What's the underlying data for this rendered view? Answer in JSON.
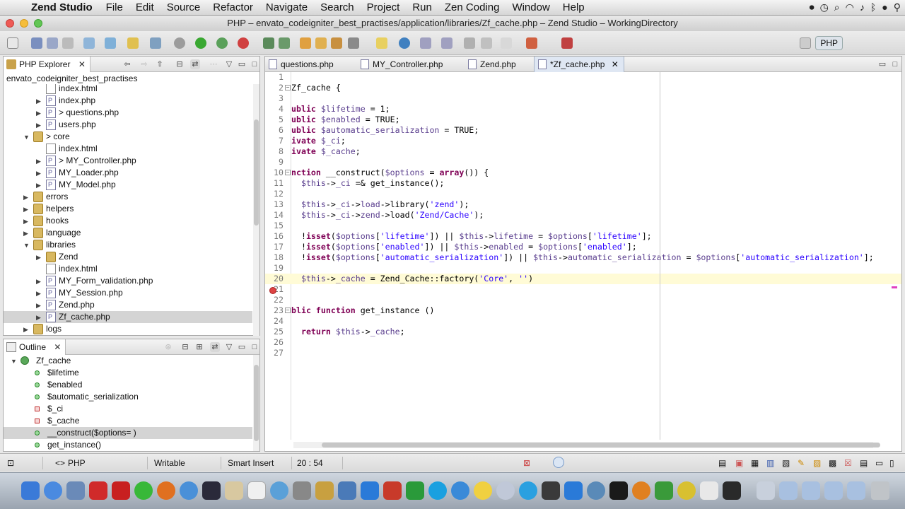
{
  "menubar": {
    "app_name": "Zend Studio",
    "items": [
      "File",
      "Edit",
      "Source",
      "Refactor",
      "Navigate",
      "Search",
      "Project",
      "Run",
      "Zen Coding",
      "Window",
      "Help"
    ]
  },
  "window": {
    "title": "PHP – envato_codeigniter_best_practises/application/libraries/Zf_cache.php – Zend Studio – WorkingDirectory"
  },
  "toolbar": {
    "perspective_label": "PHP"
  },
  "php_explorer": {
    "tab_label": "PHP Explorer",
    "project_name": "envato_codeigniter_best_practises",
    "tree": [
      {
        "label": "index.html",
        "indent": 3,
        "icon": "file",
        "twisty": ""
      },
      {
        "label": "index.php",
        "indent": 3,
        "icon": "php",
        "twisty": "▶"
      },
      {
        "label": "> questions.php",
        "indent": 3,
        "icon": "php",
        "twisty": "▶"
      },
      {
        "label": "users.php",
        "indent": 3,
        "icon": "php",
        "twisty": "▶"
      },
      {
        "label": "> core",
        "indent": 2,
        "icon": "pkg",
        "twisty": "▼"
      },
      {
        "label": "index.html",
        "indent": 3,
        "icon": "file",
        "twisty": ""
      },
      {
        "label": "> MY_Controller.php",
        "indent": 3,
        "icon": "php",
        "twisty": "▶"
      },
      {
        "label": "MY_Loader.php",
        "indent": 3,
        "icon": "php",
        "twisty": "▶"
      },
      {
        "label": "MY_Model.php",
        "indent": 3,
        "icon": "php",
        "twisty": "▶"
      },
      {
        "label": "errors",
        "indent": 2,
        "icon": "pkg",
        "twisty": "▶"
      },
      {
        "label": "helpers",
        "indent": 2,
        "icon": "pkg",
        "twisty": "▶"
      },
      {
        "label": "hooks",
        "indent": 2,
        "icon": "pkg",
        "twisty": "▶"
      },
      {
        "label": "language",
        "indent": 2,
        "icon": "pkg",
        "twisty": "▶"
      },
      {
        "label": "libraries",
        "indent": 2,
        "icon": "pkg",
        "twisty": "▼"
      },
      {
        "label": "Zend",
        "indent": 3,
        "icon": "pkg",
        "twisty": "▶"
      },
      {
        "label": "index.html",
        "indent": 3,
        "icon": "file",
        "twisty": ""
      },
      {
        "label": "MY_Form_validation.php",
        "indent": 3,
        "icon": "php",
        "twisty": "▶"
      },
      {
        "label": "MY_Session.php",
        "indent": 3,
        "icon": "php",
        "twisty": "▶"
      },
      {
        "label": "Zend.php",
        "indent": 3,
        "icon": "php",
        "twisty": "▶"
      },
      {
        "label": "Zf_cache.php",
        "indent": 3,
        "icon": "php",
        "twisty": "▶",
        "selected": true
      },
      {
        "label": "logs",
        "indent": 2,
        "icon": "pkg",
        "twisty": "▶"
      }
    ]
  },
  "outline": {
    "tab_label": "Outline",
    "root": "Zf_cache",
    "items": [
      {
        "label": "$lifetime",
        "kind": "public"
      },
      {
        "label": "$enabled",
        "kind": "public"
      },
      {
        "label": "$automatic_serialization",
        "kind": "public"
      },
      {
        "label": "$_ci",
        "kind": "private"
      },
      {
        "label": "$_cache",
        "kind": "private"
      },
      {
        "label": "__construct($options= )",
        "kind": "public",
        "selected": true
      },
      {
        "label": "get_instance()",
        "kind": "public"
      }
    ]
  },
  "editor": {
    "tabs": [
      {
        "label": "questions.php",
        "active": false
      },
      {
        "label": "MY_Controller.php",
        "active": false
      },
      {
        "label": "Zend.php",
        "active": false
      },
      {
        "label": "*Zf_cache.php",
        "active": true
      }
    ],
    "lines": [
      {
        "n": "1",
        "fold": "",
        "html": ""
      },
      {
        "n": "2",
        "fold": "⊟",
        "html": "Zf_cache {"
      },
      {
        "n": "3",
        "fold": "",
        "html": ""
      },
      {
        "n": "4",
        "fold": "",
        "html": "<span class=\"kw\">ublic</span> <span class=\"vr\">$lifetime</span> = 1;"
      },
      {
        "n": "5",
        "fold": "",
        "html": "<span class=\"kw\">ublic</span> <span class=\"vr\">$enabled</span> = TRUE;"
      },
      {
        "n": "6",
        "fold": "",
        "html": "<span class=\"kw\">ublic</span> <span class=\"vr\">$automatic_serialization</span> = TRUE;"
      },
      {
        "n": "7",
        "fold": "",
        "html": "<span class=\"kw\">ivate</span> <span class=\"vr\">$_ci</span>;"
      },
      {
        "n": "8",
        "fold": "",
        "html": "<span class=\"kw\">ivate</span> <span class=\"vr\">$_cache</span>;"
      },
      {
        "n": "9",
        "fold": "",
        "html": ""
      },
      {
        "n": "10",
        "fold": "⊟",
        "html": "<span class=\"kw\">nction</span> __construct(<span class=\"vr\">$options</span> = <span class=\"kw\">array</span>()) {"
      },
      {
        "n": "11",
        "fold": "",
        "html": "  <span class=\"vr\">$this</span>-><span class=\"vr\">_ci</span> =&amp; get_instance();"
      },
      {
        "n": "12",
        "fold": "",
        "html": ""
      },
      {
        "n": "13",
        "fold": "",
        "html": "  <span class=\"vr\">$this</span>-><span class=\"vr\">_ci</span>-><span class=\"vr\">load</span>->library(<span class=\"st\">'zend'</span>);"
      },
      {
        "n": "14",
        "fold": "",
        "html": "  <span class=\"vr\">$this</span>-><span class=\"vr\">_ci</span>-><span class=\"vr\">zend</span>->load(<span class=\"st\">'Zend/Cache'</span>);"
      },
      {
        "n": "15",
        "fold": "",
        "html": ""
      },
      {
        "n": "16",
        "fold": "",
        "html": "  !<span class=\"kw\">isset</span>(<span class=\"vr\">$options</span>[<span class=\"st\">'lifetime'</span>]) || <span class=\"vr\">$this</span>-><span class=\"vr\">lifetime</span> = <span class=\"vr\">$options</span>[<span class=\"st\">'lifetime'</span>];"
      },
      {
        "n": "17",
        "fold": "",
        "html": "  !<span class=\"kw\">isset</span>(<span class=\"vr\">$options</span>[<span class=\"st\">'enabled'</span>]) || <span class=\"vr\">$this</span>-><span class=\"vr\">enabled</span> = <span class=\"vr\">$options</span>[<span class=\"st\">'enabled'</span>];"
      },
      {
        "n": "18",
        "fold": "",
        "html": "  !<span class=\"kw\">isset</span>(<span class=\"vr\">$options</span>[<span class=\"st\">'automatic_serialization'</span>]) || <span class=\"vr\">$this</span>-><span class=\"vr\">automatic_serialization</span> = <span class=\"vr\">$options</span>[<span class=\"st\">'automatic_serialization'</span>];"
      },
      {
        "n": "19",
        "fold": "",
        "html": ""
      },
      {
        "n": "20",
        "fold": "",
        "html": "  <span class=\"vr\">$this</span>-><span class=\"vr\">_cache</span> = Zend_Cache::factory(<span class=\"st\">'Core'</span>, <span class=\"st\">''</span>)",
        "current": true
      },
      {
        "n": "21",
        "fold": "",
        "html": ""
      },
      {
        "n": "22",
        "fold": "",
        "html": ""
      },
      {
        "n": "23",
        "fold": "⊟",
        "html": "<span class=\"kw\">blic function</span> get_instance ()"
      },
      {
        "n": "24",
        "fold": "",
        "html": ""
      },
      {
        "n": "25",
        "fold": "",
        "html": "  <span class=\"kw\">return</span> <span class=\"vr\">$this</span>-><span class=\"vr\">_cache</span>;"
      },
      {
        "n": "26",
        "fold": "",
        "html": ""
      },
      {
        "n": "27",
        "fold": "",
        "html": ""
      }
    ]
  },
  "statusbar": {
    "language": "PHP",
    "writable": "Writable",
    "insert_mode": "Smart Insert",
    "cursor_position": "20 : 54"
  },
  "colors": {
    "keyword": "#7f0055",
    "variable": "#5a3e8e",
    "string": "#2a00ff",
    "current_line": "#fffbd6",
    "selection": "#d4d4d4"
  }
}
